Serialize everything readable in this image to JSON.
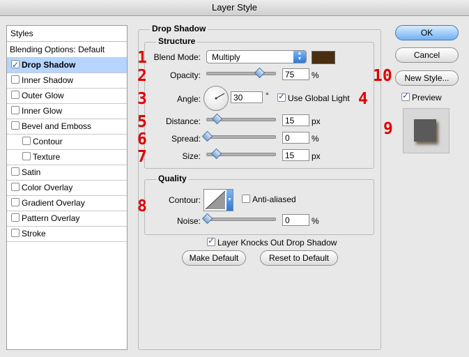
{
  "window": {
    "title": "Layer Style"
  },
  "styles": {
    "header": "Styles",
    "blending": "Blending Options: Default",
    "items": [
      {
        "label": "Drop Shadow",
        "checked": true,
        "selected": true
      },
      {
        "label": "Inner Shadow",
        "checked": false
      },
      {
        "label": "Outer Glow",
        "checked": false
      },
      {
        "label": "Inner Glow",
        "checked": false
      },
      {
        "label": "Bevel and Emboss",
        "checked": false
      },
      {
        "label": "Contour",
        "checked": false,
        "sub": true
      },
      {
        "label": "Texture",
        "checked": false,
        "sub": true
      },
      {
        "label": "Satin",
        "checked": false
      },
      {
        "label": "Color Overlay",
        "checked": false
      },
      {
        "label": "Gradient Overlay",
        "checked": false
      },
      {
        "label": "Pattern Overlay",
        "checked": false
      },
      {
        "label": "Stroke",
        "checked": false
      }
    ]
  },
  "drop_shadow": {
    "title": "Drop Shadow",
    "structure": {
      "title": "Structure",
      "blend_mode_label": "Blend Mode:",
      "blend_mode_value": "Multiply",
      "shadow_color": "#4a2e10",
      "opacity_label": "Opacity:",
      "opacity_value": "75",
      "opacity_unit": "%",
      "opacity_level": 0.75,
      "angle_label": "Angle:",
      "angle_value": "30",
      "angle_unit": "°",
      "use_global_light_label": "Use Global Light",
      "use_global_light": true,
      "distance_label": "Distance:",
      "distance_value": "15",
      "distance_unit": "px",
      "spread_label": "Spread:",
      "spread_value": "0",
      "spread_unit": "%",
      "size_label": "Size:",
      "size_value": "15",
      "size_unit": "px"
    },
    "quality": {
      "title": "Quality",
      "contour_label": "Contour:",
      "anti_aliased_label": "Anti-aliased",
      "anti_aliased": false,
      "noise_label": "Noise:",
      "noise_value": "0",
      "noise_unit": "%"
    },
    "knocks_out_label": "Layer Knocks Out Drop Shadow",
    "knocks_out": true,
    "make_default_label": "Make Default",
    "reset_default_label": "Reset to Default"
  },
  "buttons": {
    "ok": "OK",
    "cancel": "Cancel",
    "new_style": "New Style...",
    "preview_label": "Preview",
    "preview": true
  },
  "annotations": [
    "1",
    "2",
    "3",
    "4",
    "5",
    "6",
    "7",
    "8",
    "9",
    "10"
  ]
}
